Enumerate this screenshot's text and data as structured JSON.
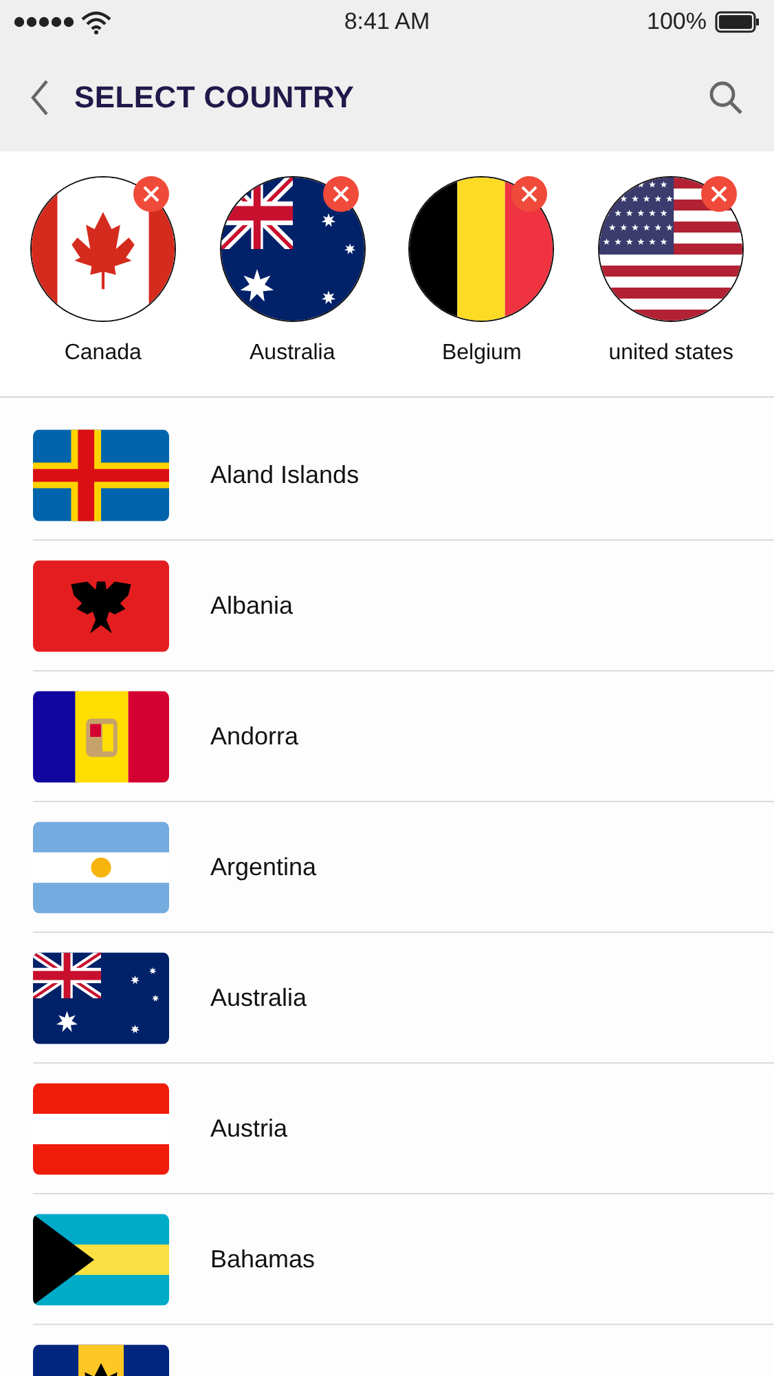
{
  "status_bar": {
    "time": "8:41 AM",
    "battery": "100%"
  },
  "header": {
    "title": "SELECT COUNTRY"
  },
  "selected_countries": [
    {
      "name": "Canada",
      "kind": "maple"
    },
    {
      "name": "Australia",
      "kind": "union"
    },
    {
      "name": "Belgium",
      "kind": "tricolor"
    },
    {
      "name": "united states",
      "kind": "stars"
    }
  ],
  "countries": [
    {
      "name": "Aland Islands",
      "kind": "cross"
    },
    {
      "name": "Albania",
      "kind": "eagle"
    },
    {
      "name": "Andorra",
      "kind": "crest"
    },
    {
      "name": "Argentina",
      "kind": "sun"
    },
    {
      "name": "Australia",
      "kind": "union"
    },
    {
      "name": "Austria",
      "kind": "bands"
    },
    {
      "name": "Bahamas",
      "kind": "triangle"
    },
    {
      "kind": "trident"
    }
  ]
}
